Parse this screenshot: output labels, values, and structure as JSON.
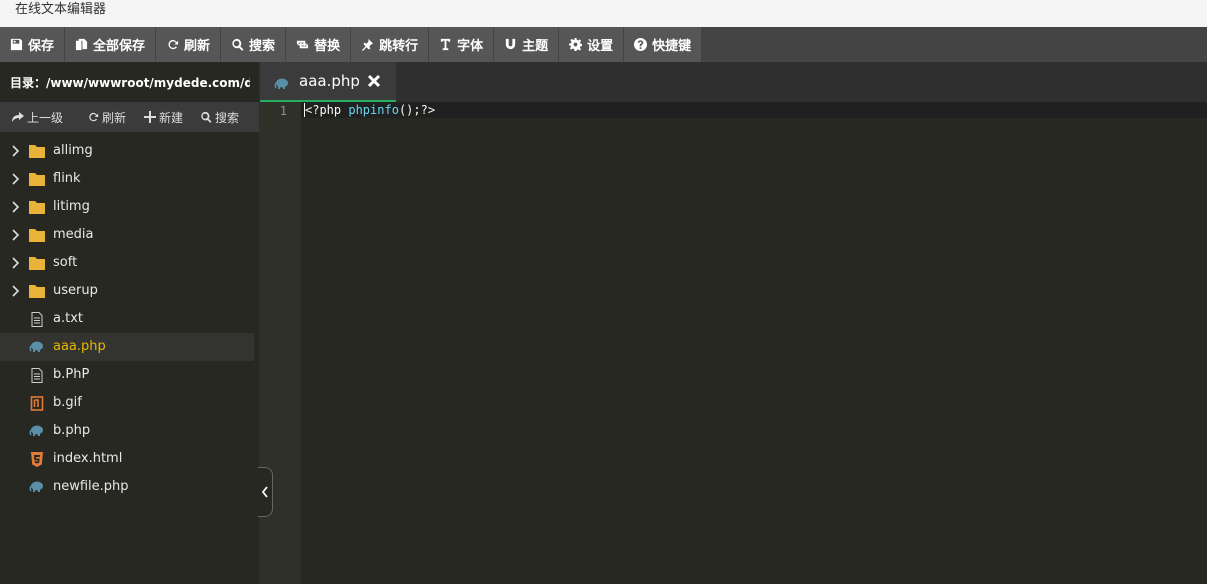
{
  "app": {
    "title": "在线文本编辑器"
  },
  "toolbar": {
    "save": "保存",
    "save_all": "全部保存",
    "refresh": "刷新",
    "search": "搜索",
    "replace": "替换",
    "goto_line": "跳转行",
    "font": "字体",
    "theme": "主题",
    "settings": "设置",
    "shortcuts": "快捷键"
  },
  "sidebar": {
    "directory": "目录：/www/wwwroot/mydede.com/d...",
    "tools": {
      "up": "上一级",
      "refresh": "刷新",
      "new": "新建",
      "search": "搜索"
    },
    "folders": [
      {
        "name": "allimg"
      },
      {
        "name": "flink"
      },
      {
        "name": "litimg"
      },
      {
        "name": "media"
      },
      {
        "name": "soft"
      },
      {
        "name": "userup"
      }
    ],
    "files": [
      {
        "name": "a.txt",
        "icon": "text-file-icon"
      },
      {
        "name": "aaa.php",
        "icon": "php-elephant-icon",
        "active": true
      },
      {
        "name": "b.PhP",
        "icon": "text-file-icon"
      },
      {
        "name": "b.gif",
        "icon": "image-file-icon"
      },
      {
        "name": "b.php",
        "icon": "php-elephant-icon"
      },
      {
        "name": "index.html",
        "icon": "html5-icon"
      },
      {
        "name": "newfile.php",
        "icon": "php-elephant-icon"
      }
    ]
  },
  "editor": {
    "tab_label": "aaa.php",
    "line_number": "1",
    "code_open": "<?php ",
    "code_func": "phpinfo",
    "code_rest": "();?>"
  },
  "colors": {
    "toolbar_bg": "#565656",
    "editor_bg": "#272822",
    "active_file": "#e6b800",
    "folder": "#e8b339",
    "tab_accent": "#27ae60",
    "keyword": "#66d9ef"
  }
}
